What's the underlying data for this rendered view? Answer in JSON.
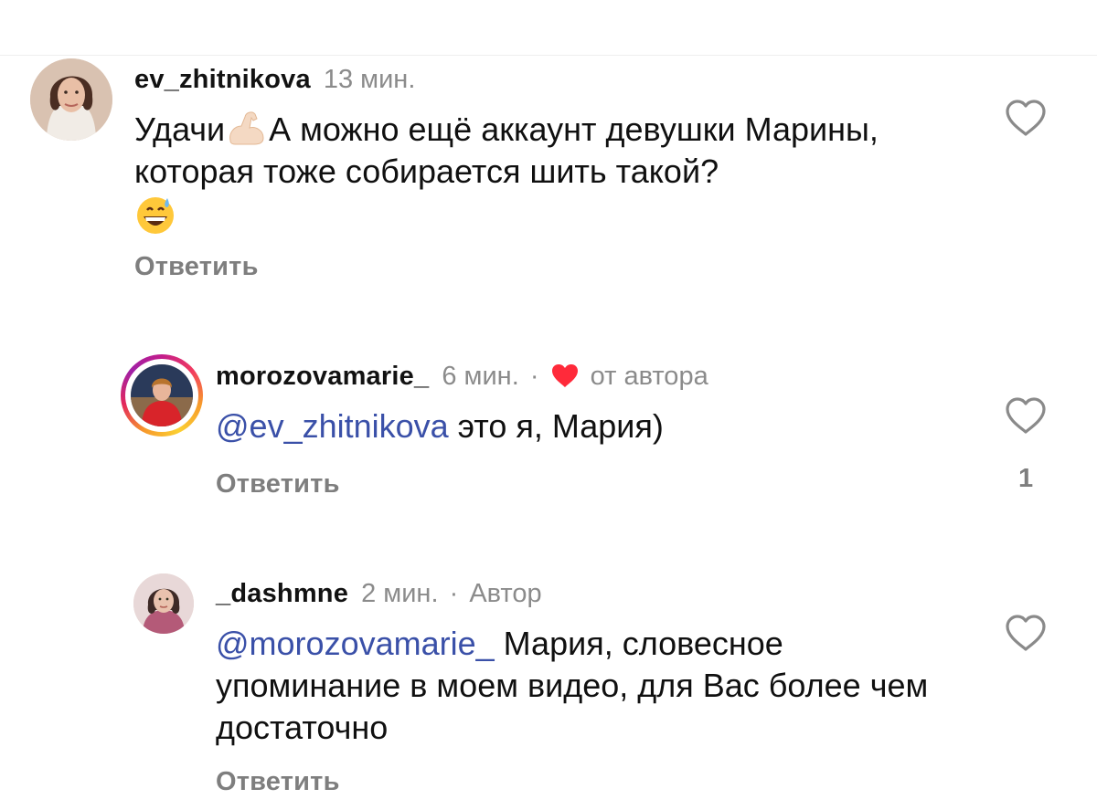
{
  "comments": [
    {
      "username": "ev_zhitnikova",
      "time": "13 мин.",
      "text_part1": "Удачи",
      "text_part2": "А можно ещё аккаунт девушки Марины, которая тоже собирается шить такой?",
      "emoji_1": "flexed-biceps",
      "emoji_2": "grinning-sweat-face",
      "reply_label": "Ответить"
    },
    {
      "username": "morozovamarie_",
      "time": "6 мин.",
      "separator": "·",
      "liked_by_author_label": "от автора",
      "mention": "@ev_zhitnikova",
      "text": " это я, Мария)",
      "reply_label": "Ответить",
      "like_count": "1"
    },
    {
      "username": "_dashmne",
      "time": "2 мин.",
      "separator": "·",
      "author_badge": "Автор",
      "mention": "@morozovamarie_",
      "text": " Мария, словесное упоминание в моем видео, для Вас более чем достаточно",
      "reply_label": "Ответить"
    }
  ],
  "colors": {
    "mention": "#3a50a8",
    "meta": "#8b8b8b",
    "heart_red": "#ff2a3a"
  }
}
